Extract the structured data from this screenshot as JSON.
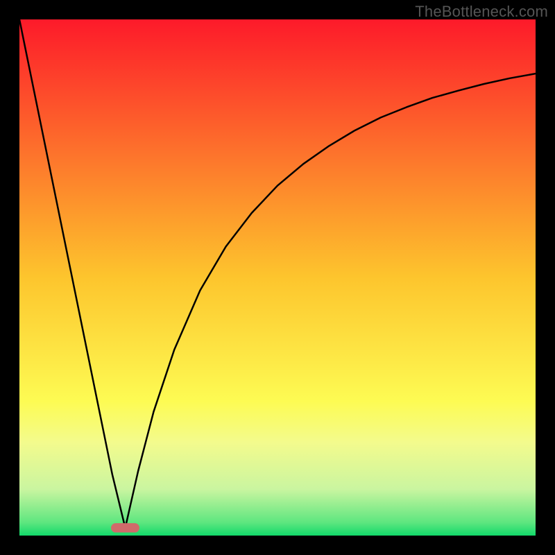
{
  "watermark": "TheBottleneck.com",
  "chart_data": {
    "type": "line",
    "title": "",
    "xlabel": "",
    "ylabel": "",
    "xlim": [
      0,
      1
    ],
    "ylim": [
      0,
      1
    ],
    "background": {
      "type": "vertical-gradient",
      "stops": [
        {
          "offset": 0.0,
          "color": "#fd1a2a"
        },
        {
          "offset": 0.5,
          "color": "#fdc52d"
        },
        {
          "offset": 0.74,
          "color": "#fdfb53"
        },
        {
          "offset": 0.82,
          "color": "#f3fb8d"
        },
        {
          "offset": 0.91,
          "color": "#caf5a0"
        },
        {
          "offset": 0.975,
          "color": "#5de67f"
        },
        {
          "offset": 1.0,
          "color": "#12d96a"
        }
      ]
    },
    "marker": {
      "x": 0.205,
      "y": 0.985,
      "color": "#d06a6a",
      "shape": "rounded-rect",
      "width_frac": 0.055,
      "height_frac": 0.018
    },
    "series": [
      {
        "name": "bottleneck-curve-left",
        "type": "line",
        "color": "#000000",
        "x": [
          0.0,
          0.05,
          0.1,
          0.15,
          0.18,
          0.205
        ],
        "y": [
          0.0,
          0.245,
          0.49,
          0.735,
          0.882,
          0.985
        ]
      },
      {
        "name": "bottleneck-curve-right",
        "type": "line",
        "color": "#000000",
        "x": [
          0.205,
          0.23,
          0.26,
          0.3,
          0.35,
          0.4,
          0.45,
          0.5,
          0.55,
          0.6,
          0.65,
          0.7,
          0.75,
          0.8,
          0.85,
          0.9,
          0.95,
          1.0
        ],
        "y": [
          0.985,
          0.875,
          0.76,
          0.64,
          0.525,
          0.44,
          0.375,
          0.322,
          0.28,
          0.245,
          0.215,
          0.19,
          0.17,
          0.152,
          0.138,
          0.125,
          0.114,
          0.105
        ]
      }
    ]
  }
}
